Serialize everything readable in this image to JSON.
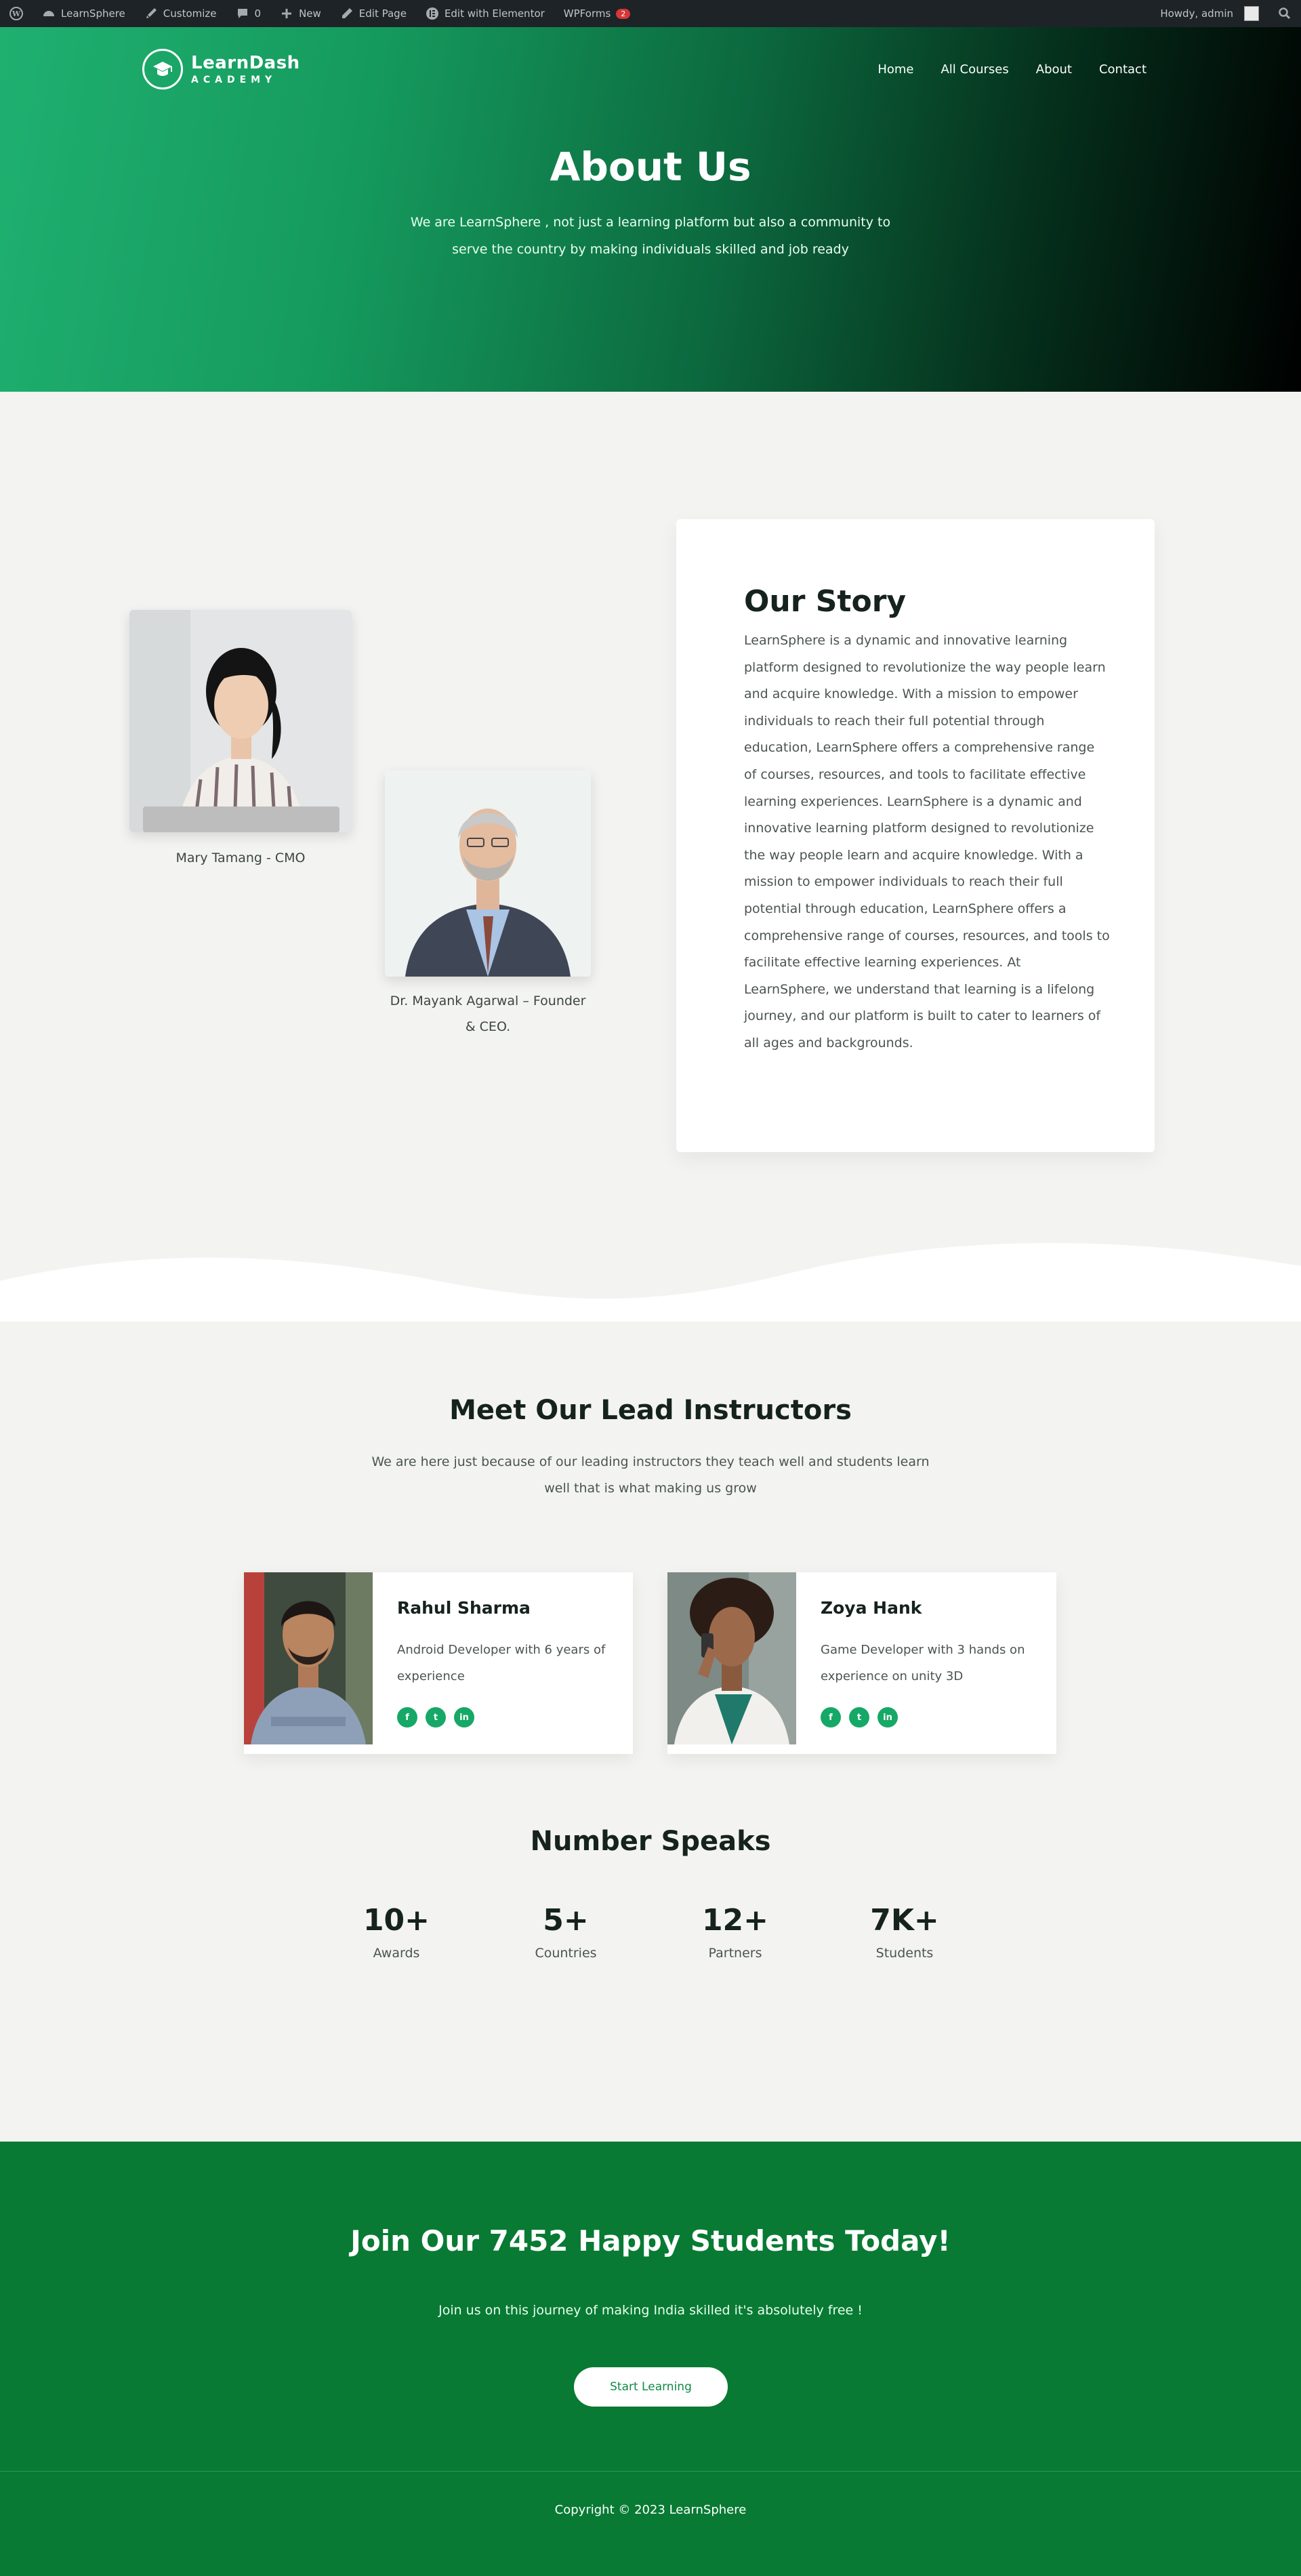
{
  "admin_bar": {
    "site": "LearnSphere",
    "customize": "Customize",
    "comments": "0",
    "new": "New",
    "edit_page": "Edit Page",
    "elementor": "Edit with Elementor",
    "wpforms": "WPForms",
    "wpforms_badge": "2",
    "howdy": "Howdy, admin"
  },
  "header": {
    "logo_line1": "LearnDash",
    "logo_line2": "ACADEMY",
    "nav": [
      "Home",
      "All Courses",
      "About",
      "Contact"
    ]
  },
  "hero": {
    "title": "About Us",
    "subtitle": "We are LearnSphere , not just a learning platform but also a community to serve the country by making individuals skilled and job ready"
  },
  "story": {
    "person1_caption": "Mary Tamang - CMO",
    "person2_caption": "Dr. Mayank Agarwal – Founder & CEO.",
    "title": "Our Story",
    "body": "LearnSphere is a dynamic and innovative learning platform designed to revolutionize the way people learn and acquire knowledge. With a mission to empower individuals to reach their full potential through education, LearnSphere offers a comprehensive range of courses, resources, and tools to facilitate effective learning experiences. LearnSphere is a dynamic and innovative learning platform designed to revolutionize the way people learn and acquire knowledge. With a mission to empower individuals to reach their full potential through education, LearnSphere offers a comprehensive range of courses, resources, and tools to facilitate effective learning experiences. At LearnSphere, we understand that learning is a lifelong journey, and our platform is built to cater to learners of all ages and backgrounds."
  },
  "instructors": {
    "title": "Meet Our Lead Instructors",
    "subtitle": "We are here just because of our leading instructors they teach well and students learn well that is what making us grow",
    "items": [
      {
        "name": "Rahul Sharma",
        "desc": "Android Developer with 6 years of experience"
      },
      {
        "name": "Zoya Hank",
        "desc": "Game Developer with 3 hands on experience on unity 3D"
      }
    ],
    "social_icons": [
      "f",
      "t",
      "in"
    ]
  },
  "numbers": {
    "title": "Number Speaks",
    "stats": [
      {
        "value": "10+",
        "label": "Awards"
      },
      {
        "value": "5+",
        "label": "Countries"
      },
      {
        "value": "12+",
        "label": "Partners"
      },
      {
        "value": "7K+",
        "label": "Students"
      }
    ]
  },
  "cta": {
    "title": "Join Our 7452 Happy Students Today!",
    "subtitle": "Join us on this journey of making India skilled it's absolutely free !",
    "button": "Start Learning"
  },
  "footer": {
    "copyright": "Copyright © 2023 LearnSphere"
  },
  "colors": {
    "accent": "#16a866",
    "cta_bg": "#087a33",
    "admin_bar": "#1d2327"
  }
}
